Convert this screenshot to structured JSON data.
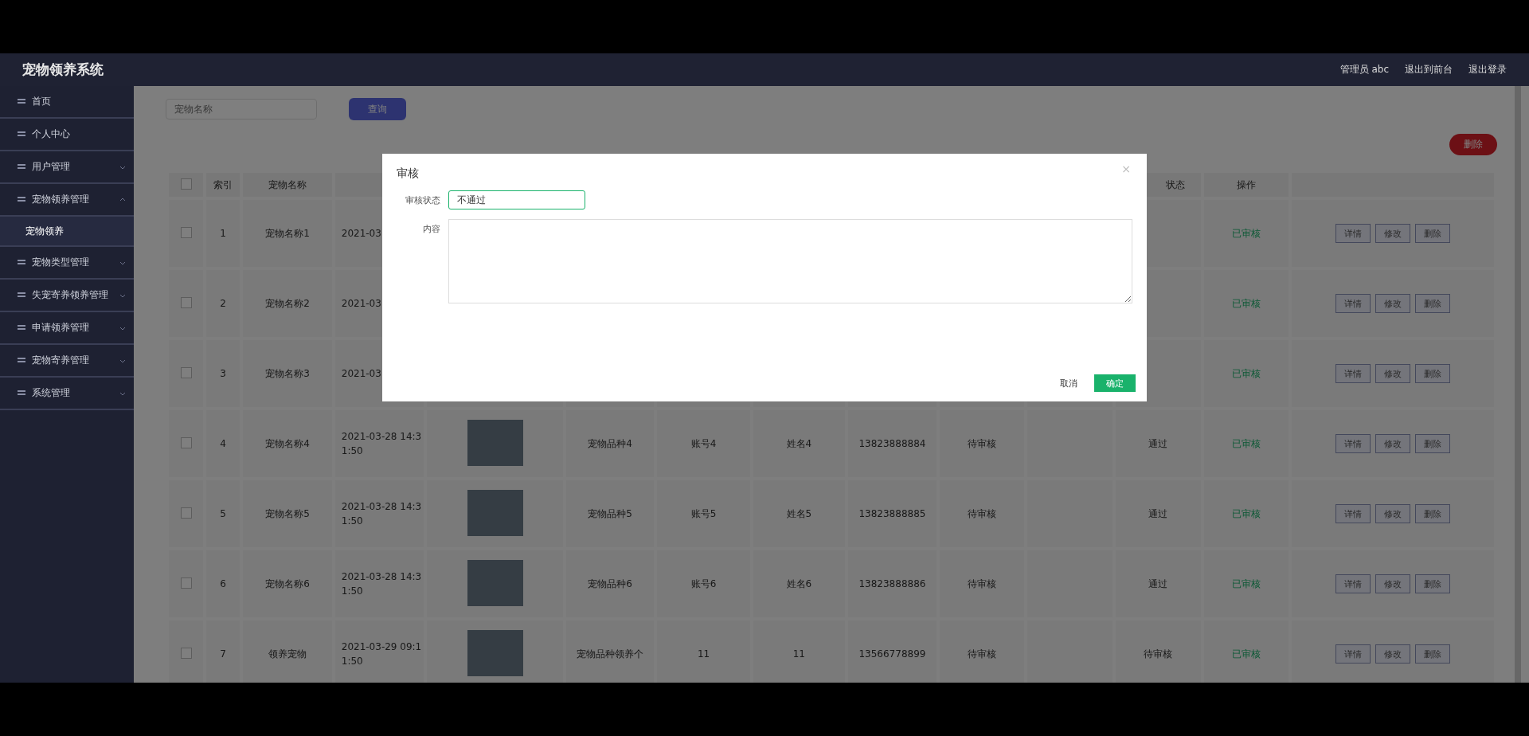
{
  "header": {
    "title": "宠物领养系统",
    "user": "管理员 abc",
    "links": [
      "退出到前台",
      "退出登录"
    ]
  },
  "sidebar": {
    "items": [
      {
        "label": "首页",
        "kind": "link",
        "selected": false
      },
      {
        "label": "个人中心",
        "kind": "link",
        "selected": false
      },
      {
        "label": "用户管理",
        "kind": "menu",
        "expanded": false,
        "selected": false
      },
      {
        "label": "宠物领养管理",
        "kind": "menu",
        "expanded": true,
        "selected": false,
        "children": [
          {
            "label": "宠物领养",
            "selected": true
          }
        ]
      },
      {
        "label": "宠物类型管理",
        "kind": "menu",
        "expanded": false,
        "selected": false
      },
      {
        "label": "失宠寄养领养管理",
        "kind": "menu",
        "expanded": false,
        "selected": false
      },
      {
        "label": "申请领养管理",
        "kind": "menu",
        "expanded": false,
        "selected": false
      },
      {
        "label": "宠物寄养管理",
        "kind": "menu",
        "expanded": false,
        "selected": false
      },
      {
        "label": "系统管理",
        "kind": "menu",
        "expanded": false,
        "selected": false
      }
    ]
  },
  "search": {
    "placeholder": "宠物名称",
    "button": "查询"
  },
  "delete_button": "删除",
  "table": {
    "columns": [
      {
        "label": "索引"
      },
      {
        "label": "宠物名称"
      },
      null,
      null,
      null,
      null,
      null,
      null,
      null,
      null,
      {
        "label": "状态"
      },
      {
        "label": "操作"
      }
    ],
    "rows": [
      {
        "checked": false,
        "index": "1",
        "name": "宠物名称1",
        "time": "2021-03",
        "reply": "已审核",
        "actions": [
          "详情",
          "修改",
          "删除"
        ]
      },
      {
        "checked": false,
        "index": "2",
        "name": "宠物名称2",
        "time": "2021-03",
        "reply": "已审核",
        "actions": [
          "详情",
          "修改",
          "删除"
        ]
      },
      {
        "checked": false,
        "index": "3",
        "name": "宠物名称3",
        "time": "2021-03",
        "reply": "已审核",
        "actions": [
          "详情",
          "修改",
          "删除"
        ]
      },
      {
        "checked": false,
        "index": "4",
        "name": "宠物名称4",
        "time": "2021-03-28 14:31:50",
        "photo": true,
        "breed": "宠物品种4",
        "account": "账号4",
        "person": "姓名4",
        "phone": "13823888884",
        "col9": "待审核",
        "status": "通过",
        "reply": "已审核",
        "actions": [
          "详情",
          "修改",
          "删除"
        ]
      },
      {
        "checked": false,
        "index": "5",
        "name": "宠物名称5",
        "time": "2021-03-28 14:31:50",
        "photo": true,
        "breed": "宠物品种5",
        "account": "账号5",
        "person": "姓名5",
        "phone": "13823888885",
        "col9": "待审核",
        "status": "通过",
        "reply": "已审核",
        "actions": [
          "详情",
          "修改",
          "删除"
        ]
      },
      {
        "checked": false,
        "index": "6",
        "name": "宠物名称6",
        "time": "2021-03-28 14:31:50",
        "photo": true,
        "breed": "宠物品种6",
        "account": "账号6",
        "person": "姓名6",
        "phone": "13823888886",
        "col9": "待审核",
        "status": "通过",
        "reply": "已审核",
        "actions": [
          "详情",
          "修改",
          "删除"
        ]
      },
      {
        "checked": false,
        "index": "7",
        "name": "领养宠物",
        "time": "2021-03-29 09:11:50",
        "photo": true,
        "breed": "宠物品种领养个",
        "account": "11",
        "person": "11",
        "phone": "13566778899",
        "col9": "待审核",
        "status": "待审核",
        "reply": "已审核",
        "actions": [
          "详情",
          "修改",
          "删除"
        ]
      }
    ],
    "select_all_checked": false
  },
  "dialog": {
    "title": "审核",
    "close": "×",
    "fields": [
      {
        "label": "审核状态",
        "kind": "select",
        "value": "不通过"
      },
      {
        "label": "内容",
        "kind": "textarea"
      }
    ],
    "buttons": [
      "取消",
      "确定"
    ]
  }
}
